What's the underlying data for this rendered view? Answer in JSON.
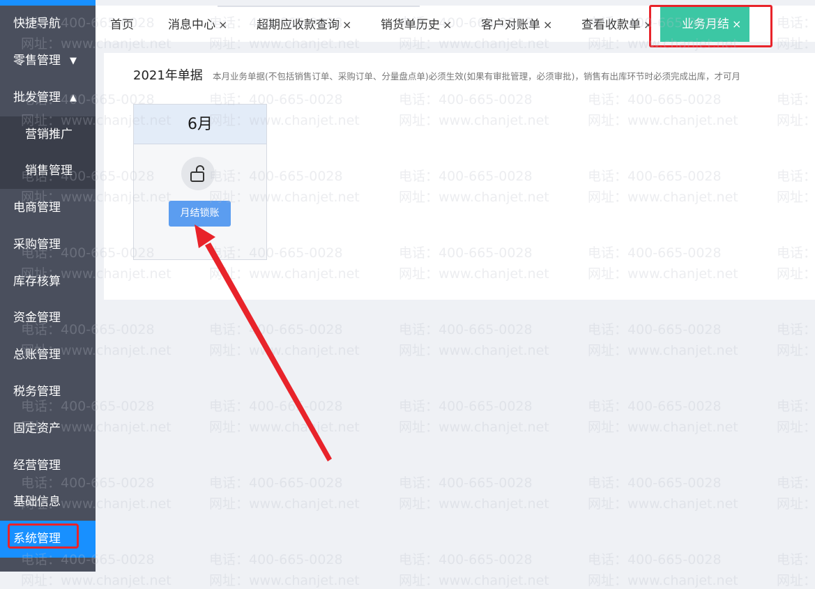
{
  "sidebar": {
    "items": [
      {
        "label": "快捷导航"
      },
      {
        "label": "零售管理",
        "arrow": "▼"
      },
      {
        "label": "批发管理",
        "arrow": "▲"
      },
      {
        "label": "电商管理"
      },
      {
        "label": "采购管理"
      },
      {
        "label": "库存核算"
      },
      {
        "label": "资金管理"
      },
      {
        "label": "总账管理"
      },
      {
        "label": "税务管理"
      },
      {
        "label": "固定资产"
      },
      {
        "label": "经营管理"
      },
      {
        "label": "基础信息"
      },
      {
        "label": "系统管理"
      }
    ],
    "submenu": [
      {
        "label": "营销推广"
      },
      {
        "label": "销售管理"
      }
    ],
    "accent_color": "#1890ff"
  },
  "tabs": [
    {
      "label": "首页",
      "close": ""
    },
    {
      "label": "消息中心",
      "close": "×"
    },
    {
      "label": "超期应收款查询",
      "close": "×"
    },
    {
      "label": "销货单历史",
      "close": "×"
    },
    {
      "label": "客户对账单",
      "close": "×"
    },
    {
      "label": "查看收款单",
      "close": "×"
    },
    {
      "label": "业务月结",
      "close": "×"
    }
  ],
  "active_tab_color": "#3cc7a4",
  "content": {
    "year_title": "2021年单据",
    "note": "本月业务单据(不包括销售订单、采购订单、分量盘点单)必须生效(如果有审批管理，必须审批)，销售有出库环节时必须完成出库，才可月",
    "month": "6月",
    "lock_icon": "unlock-icon",
    "lock_button": "月结锁账"
  },
  "watermark": {
    "phone": "电话：400-665-0028",
    "site": "网址：www.chanjet.net"
  },
  "annotation_color": "#e8232a"
}
